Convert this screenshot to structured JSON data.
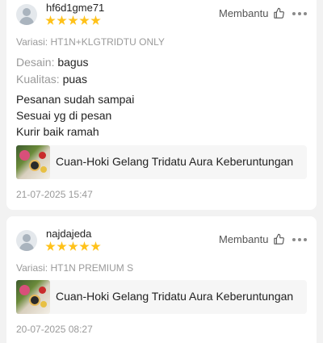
{
  "reviews": [
    {
      "username": "hf6d1gme71",
      "rating": 5,
      "helpful_label": "Membantu",
      "variant": "Variasi: HT1N+KLGTRIDTU ONLY",
      "attributes": [
        {
          "key": "Desain:",
          "value": "bagus"
        },
        {
          "key": "Kualitas:",
          "value": "puas"
        }
      ],
      "text_lines": [
        "Pesanan sudah sampai",
        "Sesuai yg di pesan",
        "Kurir baik ramah"
      ],
      "product_title": "Cuan-Hoki Gelang Tridatu Aura Keberuntungan",
      "date": "21-07-2025 15:47"
    },
    {
      "username": "najdajeda",
      "rating": 5,
      "helpful_label": "Membantu",
      "variant": "Variasi: HT1N PREMIUM S",
      "product_title": "Cuan-Hoki Gelang Tridatu Aura Keberuntungan",
      "date": "20-07-2025 08:27"
    }
  ],
  "colors": {
    "star": "#ffc21a",
    "muted_text": "#9a9a9a",
    "background": "#f2f2f2",
    "card": "#ffffff"
  },
  "icons": [
    "avatar-icon",
    "star-icon",
    "thumbs-up-icon",
    "more-options-icon"
  ]
}
